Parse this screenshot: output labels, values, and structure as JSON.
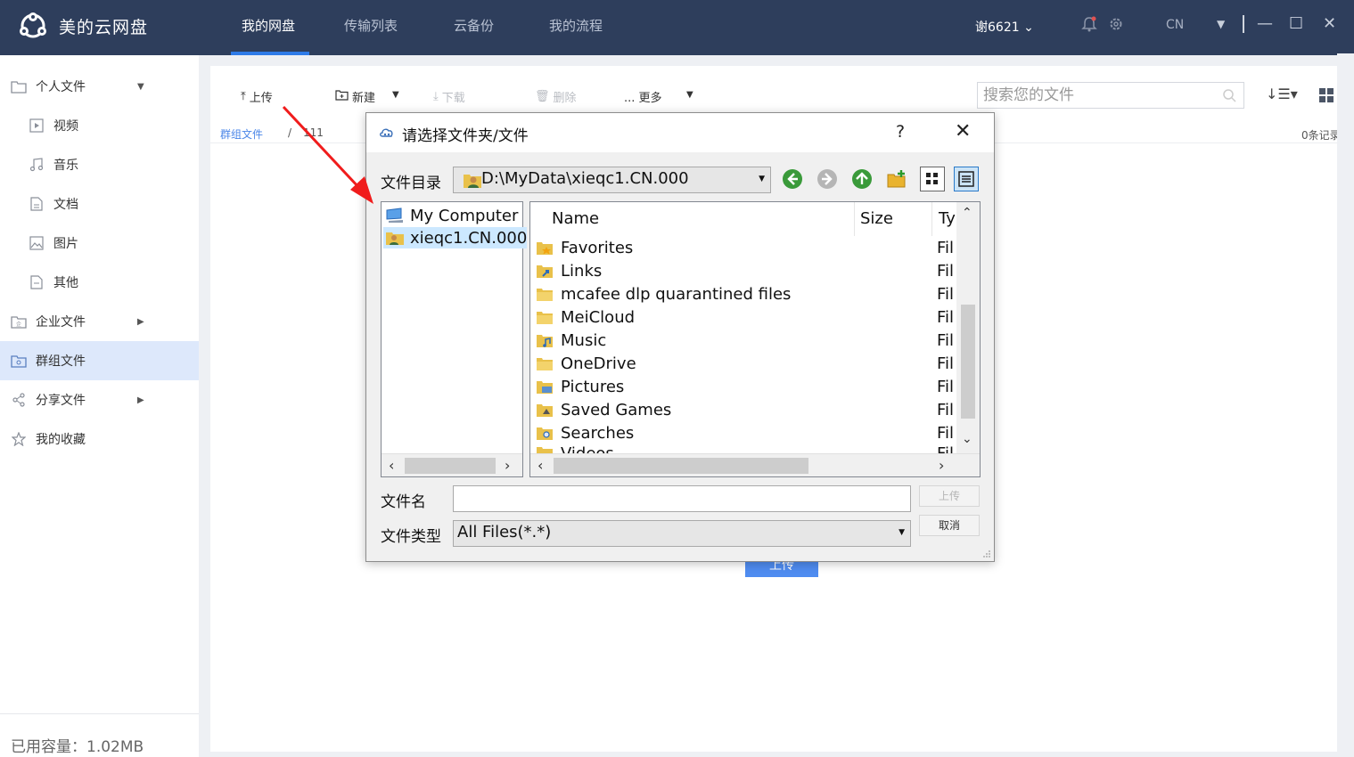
{
  "app": {
    "title": "美的云网盘",
    "nav": [
      {
        "label": "我的网盘"
      },
      {
        "label": "传输列表"
      },
      {
        "label": "云备份"
      },
      {
        "label": "我的流程"
      }
    ],
    "user": "谢6621 ⌄",
    "lang": "CN",
    "colors": {
      "topbar": "#2e3e5c",
      "accent": "#2f7be8",
      "sidebar_active": "#dde8fb"
    }
  },
  "sidebar": {
    "items": [
      {
        "label": "个人文件",
        "icon": "folder-icon"
      },
      {
        "label": "视频",
        "icon": "video-icon"
      },
      {
        "label": "音乐",
        "icon": "music-icon"
      },
      {
        "label": "文档",
        "icon": "document-icon"
      },
      {
        "label": "图片",
        "icon": "image-icon"
      },
      {
        "label": "其他",
        "icon": "other-file-icon"
      },
      {
        "label": "企业文件",
        "icon": "enterprise-folder-icon"
      },
      {
        "label": "群组文件",
        "icon": "group-folder-icon"
      },
      {
        "label": "分享文件",
        "icon": "share-icon"
      },
      {
        "label": "我的收藏",
        "icon": "star-icon"
      }
    ],
    "usage": "已用容量：1.02MB"
  },
  "toolbar": {
    "upload": "上传",
    "new": "新建",
    "download": "下载",
    "delete": "删除",
    "more": "... 更多",
    "search_placeholder": "搜索您的文件"
  },
  "breadcrumb": {
    "root": "群组文件",
    "sep": "/",
    "current": "111"
  },
  "records": "0条记录",
  "empty_upload": "上传",
  "dialog": {
    "title": "请选择文件夹/文件",
    "help": "?",
    "close": "✕",
    "dir_label": "文件目录",
    "dir_value": "D:\\MyData\\xieqc1.CN.000",
    "tree": [
      {
        "label": "My Computer"
      },
      {
        "label": "xieqc1.CN.000"
      }
    ],
    "columns": {
      "name": "Name",
      "size": "Size",
      "type": "Ty"
    },
    "files": [
      {
        "name": "Favorites",
        "type": "Fil"
      },
      {
        "name": "Links",
        "type": "Fil"
      },
      {
        "name": "mcafee dlp quarantined files",
        "type": "Fil"
      },
      {
        "name": "MeiCloud",
        "type": "Fil"
      },
      {
        "name": "Music",
        "type": "Fil"
      },
      {
        "name": "OneDrive",
        "type": "Fil"
      },
      {
        "name": "Pictures",
        "type": "Fil"
      },
      {
        "name": "Saved Games",
        "type": "Fil"
      },
      {
        "name": "Searches",
        "type": "Fil"
      },
      {
        "name": "Videos",
        "type": "Fil"
      }
    ],
    "filename_label": "文件名",
    "filename_value": "",
    "filetype_label": "文件类型",
    "filetype_value": "All Files(*.*)",
    "upload_btn": "上传",
    "cancel_btn": "取消"
  }
}
